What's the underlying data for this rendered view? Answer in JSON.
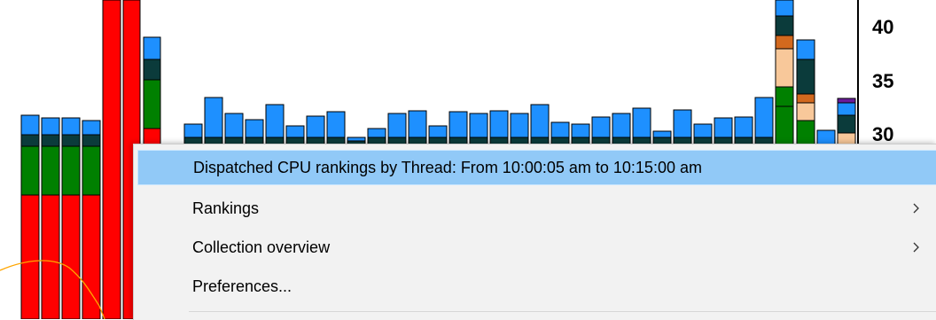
{
  "chart": {
    "y_ticks": [
      "40",
      "35",
      "30"
    ],
    "colors": {
      "red": "#ff0000",
      "green": "#008000",
      "dark_teal": "#0b3b3b",
      "blue": "#1e90ff",
      "peach": "#f8c89a",
      "orange_rust": "#d2691e",
      "purple": "#6a1b9a",
      "orange_line": "#ffa500",
      "black_outline": "#000000"
    }
  },
  "context_menu": {
    "items": [
      {
        "label": "Dispatched CPU rankings by Thread: From 10:00:05 am to 10:15:00 am",
        "has_submenu": false,
        "highlighted": true
      },
      {
        "label": "Rankings",
        "has_submenu": true,
        "highlighted": false
      },
      {
        "label": "Collection overview",
        "has_submenu": true,
        "highlighted": false
      },
      {
        "label": "Preferences...",
        "has_submenu": false,
        "highlighted": false
      }
    ]
  }
}
